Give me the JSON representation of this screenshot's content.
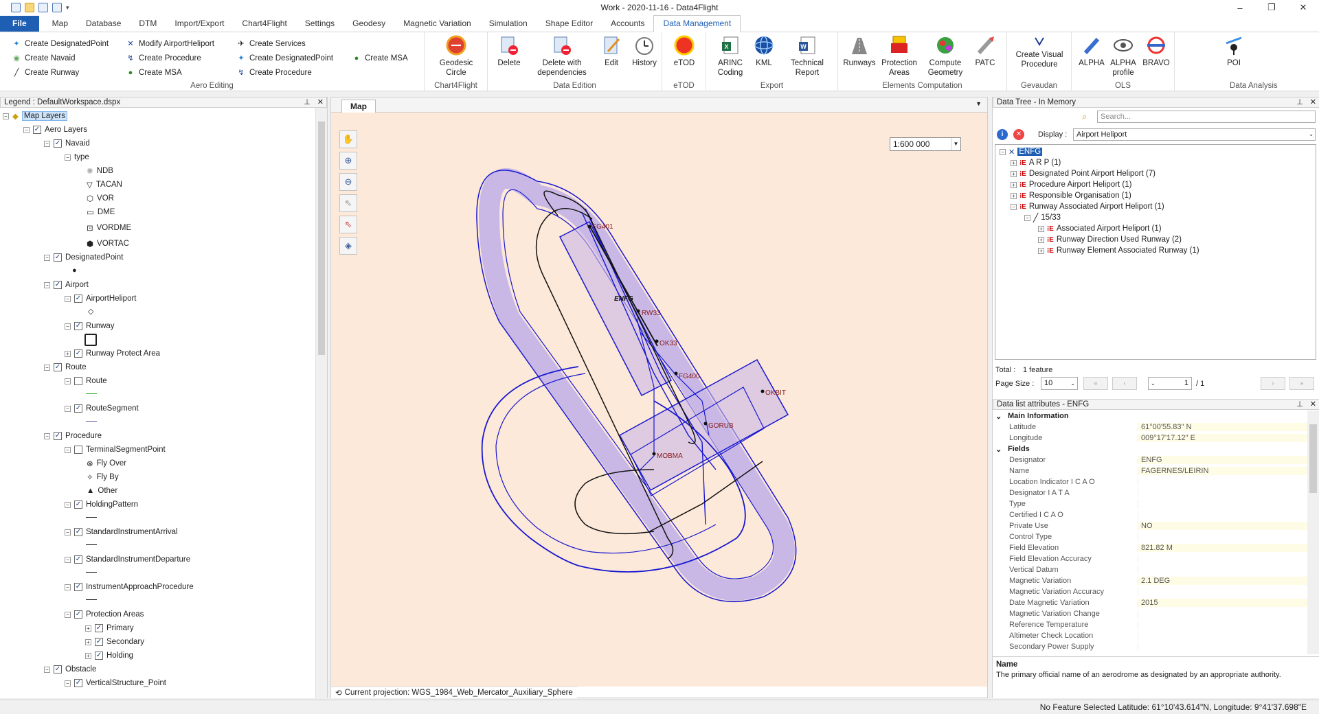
{
  "window": {
    "title": "Work - 2020-11-16 - Data4Flight",
    "minimize": "–",
    "maximize": "❐",
    "close": "✕"
  },
  "tabs": [
    "File",
    "Map",
    "Database",
    "DTM",
    "Import/Export",
    "Chart4Flight",
    "Settings",
    "Geodesy",
    "Magnetic Variation",
    "Simulation",
    "Shape Editor",
    "Accounts",
    "Data Management"
  ],
  "ribbon": {
    "aero_editing": {
      "label": "Aero Editing",
      "col1": [
        "Create DesignatedPoint",
        "Create Navaid",
        "Create Runway"
      ],
      "col2": [
        "Modify AirportHeliport",
        "Create Procedure",
        "Create MSA"
      ],
      "col3": [
        "Create Services",
        "Create DesignatedPoint",
        "Create Procedure"
      ],
      "col4": [
        "Create MSA"
      ]
    },
    "chart4flight": {
      "label": "Chart4Flight",
      "geodesic": "Geodesic Circle"
    },
    "data_edition": {
      "label": "Data Edition",
      "delete": "Delete",
      "delete_dep": "Delete with dependencies",
      "edit": "Edit",
      "history": "History"
    },
    "etod": {
      "label": "eTOD",
      "btn": "eTOD"
    },
    "export": {
      "label": "Export",
      "arinc": "ARINC Coding",
      "kml": "KML",
      "tech": "Technical Report"
    },
    "elements": {
      "label": "Elements Computation",
      "runways": "Runways",
      "protection": "Protection Areas",
      "compute": "Compute Geometry",
      "patc": "PATC"
    },
    "gevaudan": {
      "label": "Gevaudan",
      "visual": "Create Visual Procedure"
    },
    "ols": {
      "label": "OLS",
      "alpha": "ALPHA",
      "alpha_profile": "ALPHA profile",
      "bravo": "BRAVO"
    },
    "analysis": {
      "label": "Data Analysis",
      "poi": "POI"
    }
  },
  "legend": {
    "title": "Legend : DefaultWorkspace.dspx",
    "map_layers": "Map Layers",
    "aero_layers": "Aero Layers",
    "navaid": "Navaid",
    "type": "type",
    "navaid_types": [
      "NDB",
      "TACAN",
      "VOR",
      "DME",
      "VORDME",
      "VORTAC"
    ],
    "designated_point": "DesignatedPoint",
    "airport": "Airport",
    "airport_heliport": "AirportHeliport",
    "runway": "Runway",
    "runway_protect": "Runway Protect Area",
    "route": "Route",
    "route_child": "Route",
    "route_segment": "RouteSegment",
    "procedure": "Procedure",
    "tsp": "TerminalSegmentPoint",
    "fly_over": "Fly Over",
    "fly_by": "Fly By",
    "other": "Other",
    "holding_pattern": "HoldingPattern",
    "star": "StandardInstrumentArrival",
    "sid": "StandardInstrumentDeparture",
    "iap": "InstrumentApproachProcedure",
    "protection_areas": "Protection Areas",
    "primary": "Primary",
    "secondary": "Secondary",
    "holding": "Holding",
    "obstacle": "Obstacle",
    "vertical_structure": "VerticalStructure_Point"
  },
  "map": {
    "tab": "Map",
    "scale": "1:600 000",
    "projection": "Current projection: WGS_1984_Web_Mercator_Auxiliary_Sphere",
    "labels": {
      "fg401": "FG401",
      "enfg": "ENFG",
      "rw33": "RW33",
      "ok33": "OK33",
      "fg400": "FG400",
      "okbit": "OKBIT",
      "gorub": "GORUB",
      "mobma": "MOBMA"
    }
  },
  "datatree": {
    "title": "Data Tree - In Memory",
    "search_placeholder": "Search...",
    "display_label": "Display :",
    "display_value": "Airport Heliport",
    "root": "ENFG",
    "items": [
      "A R P (1)",
      "Designated Point Airport Heliport (7)",
      "Procedure Airport Heliport (1)",
      "Responsible Organisation (1)",
      "Runway Associated Airport Heliport (1)"
    ],
    "runway": "15/33",
    "runway_children": [
      "Associated Airport Heliport (1)",
      "Runway Direction Used Runway (2)",
      "Runway Element Associated Runway (1)"
    ],
    "total_label": "Total :",
    "total_value": "1 feature",
    "page_size_label": "Page Size :",
    "page_size": "10",
    "page": "1",
    "page_total": "/ 1"
  },
  "attributes": {
    "title": "Data list attributes - ENFG",
    "main_info": "Main Information",
    "main": [
      [
        "Latitude",
        "61°00'55.83\" N"
      ],
      [
        "Longitude",
        "009°17'17.12\" E"
      ]
    ],
    "fields_label": "Fields",
    "fields": [
      [
        "Designator",
        "ENFG"
      ],
      [
        "Name",
        "FAGERNES/LEIRIN"
      ],
      [
        "Location Indicator I C A O",
        ""
      ],
      [
        "Designator I A T A",
        ""
      ],
      [
        "Type",
        ""
      ],
      [
        "Certified I C A O",
        ""
      ],
      [
        "Private Use",
        "NO"
      ],
      [
        "Control Type",
        ""
      ],
      [
        "Field Elevation",
        "821.82 M"
      ],
      [
        "Field Elevation Accuracy",
        ""
      ],
      [
        "Vertical Datum",
        ""
      ],
      [
        "Magnetic Variation",
        "2.1 DEG"
      ],
      [
        "Magnetic Variation Accuracy",
        ""
      ],
      [
        "Date Magnetic Variation",
        "2015"
      ],
      [
        "Magnetic Variation Change",
        ""
      ],
      [
        "Reference Temperature",
        ""
      ],
      [
        "Altimeter Check Location",
        ""
      ],
      [
        "Secondary Power Supply",
        ""
      ]
    ],
    "desc_title": "Name",
    "desc_text": "The primary official name of an aerodrome as designated by an appropriate authority."
  },
  "status": {
    "text": "No Feature Selected  Latitude: 61°10'43.614\"N, Longitude: 9°41'37.698\"E"
  }
}
